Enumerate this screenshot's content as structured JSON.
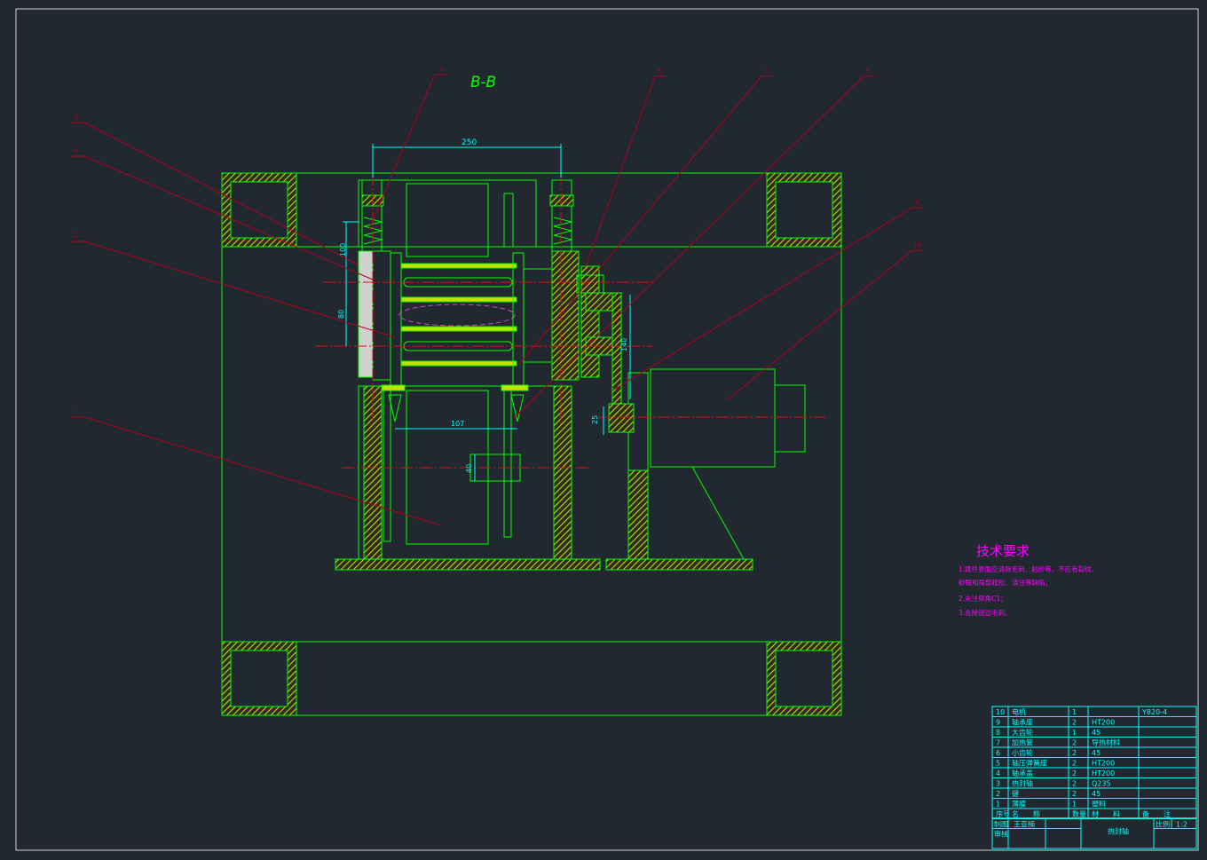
{
  "section_title": "B-B",
  "dimensions": [
    "250",
    "100",
    "80",
    "140",
    "107",
    "40",
    "25"
  ],
  "leader_labels": [
    "3",
    "4",
    "2",
    "1",
    "5",
    "6",
    "7",
    "8",
    "9",
    "10"
  ],
  "tech_requirements": {
    "title": "技术要求",
    "lines": [
      "1.铸件表面应清除毛刺、粘砂等，不应有裂纹、",
      "砂眼和局部疏松、浇注等缺陷。",
      "2.未注倒角C1；",
      "3.去除锐边毛刺。"
    ]
  },
  "bom": {
    "rows": [
      {
        "no": "10",
        "name": "电机",
        "qty": "1",
        "material": "",
        "note": "Y820-4"
      },
      {
        "no": "9",
        "name": "轴承座",
        "qty": "2",
        "material": "HT200",
        "note": ""
      },
      {
        "no": "8",
        "name": "大齿轮",
        "qty": "1",
        "material": "45",
        "note": ""
      },
      {
        "no": "7",
        "name": "加热管",
        "qty": "2",
        "material": "导热材料",
        "note": ""
      },
      {
        "no": "6",
        "name": "小齿轮",
        "qty": "2",
        "material": "45",
        "note": ""
      },
      {
        "no": "5",
        "name": "轴压弹簧座",
        "qty": "2",
        "material": "HT200",
        "note": ""
      },
      {
        "no": "4",
        "name": "轴承盖",
        "qty": "2",
        "material": "HT200",
        "note": ""
      },
      {
        "no": "3",
        "name": "热封轴",
        "qty": "2",
        "material": "Q235",
        "note": ""
      },
      {
        "no": "2",
        "name": "键",
        "qty": "2",
        "material": "45",
        "note": ""
      },
      {
        "no": "1",
        "name": "薄膜",
        "qty": "1",
        "material": "塑料",
        "note": ""
      }
    ],
    "headers": {
      "no": "序号",
      "name": "名　　称",
      "qty": "数量",
      "material": "材　　料",
      "note": "备　　注"
    },
    "drawn_label": "制图",
    "drawn_by": "王亚楠",
    "check_label": "审核",
    "title": "热封轴",
    "scale_label": "比例",
    "scale": "1:2"
  },
  "colors": {
    "background": "#212830",
    "outline": "#00ff00",
    "hatch": "#c8e000",
    "dimension": "#00ffff",
    "leader": "#b00020",
    "text": "#ff00ff"
  }
}
